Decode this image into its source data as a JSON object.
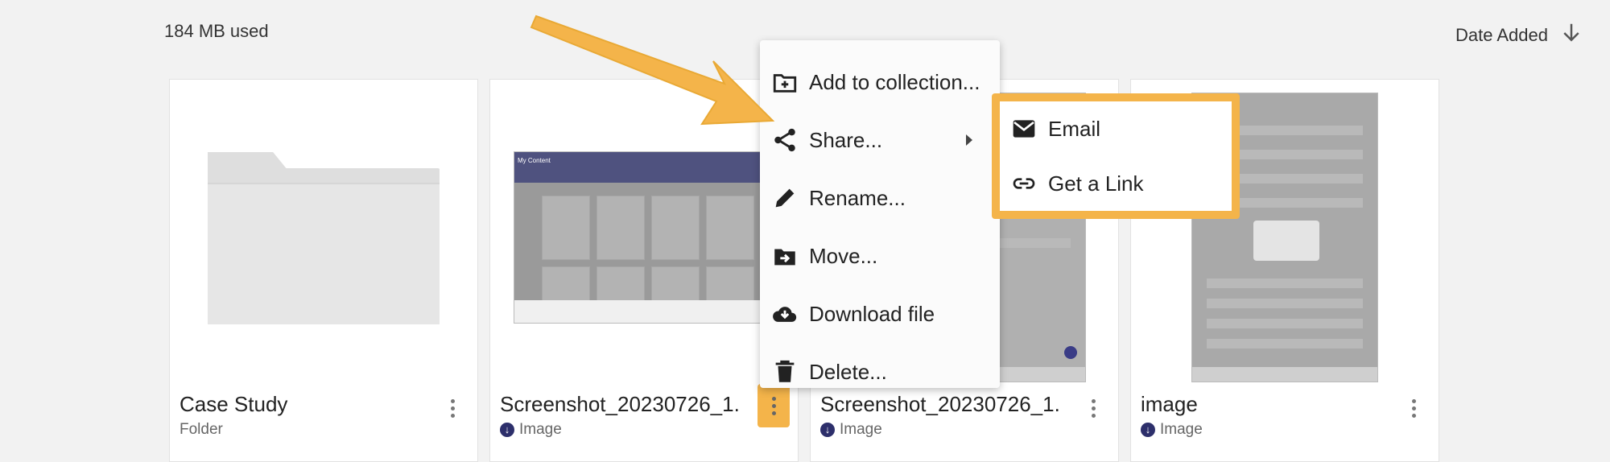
{
  "header": {
    "storage_used": "184 MB used",
    "sort_label": "Date Added",
    "sort_icon": "arrow-down-icon"
  },
  "cards": [
    {
      "name": "Case Study",
      "type": "Folder"
    },
    {
      "name": "Screenshot_20230726_1...",
      "type": "Image"
    },
    {
      "name": "Screenshot_20230726_1...",
      "type": "Image"
    },
    {
      "name": "image",
      "type": "Image"
    }
  ],
  "thumb_text": {
    "my_content": "My Content"
  },
  "context_menu": {
    "items": [
      {
        "label": "Add to collection...",
        "icon": "folder-plus-icon"
      },
      {
        "label": "Share...",
        "icon": "share-icon"
      },
      {
        "label": "Rename...",
        "icon": "pencil-icon"
      },
      {
        "label": "Move...",
        "icon": "folder-move-icon"
      },
      {
        "label": "Download file",
        "icon": "cloud-download-icon"
      },
      {
        "label": "Delete...",
        "icon": "trash-icon"
      }
    ]
  },
  "share_submenu": {
    "items": [
      {
        "label": "Email",
        "icon": "email-icon"
      },
      {
        "label": "Get a Link",
        "icon": "link-icon"
      }
    ]
  },
  "colors": {
    "highlight": "#f4b44a",
    "accent_navy": "#2d2f6b"
  }
}
